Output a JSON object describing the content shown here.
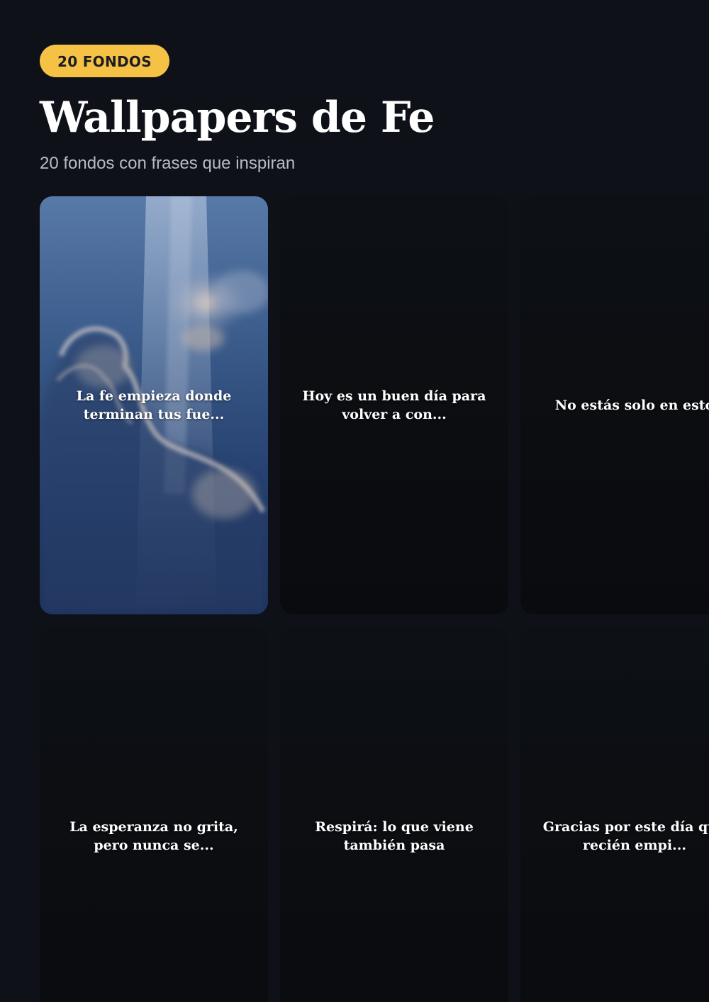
{
  "badge": "20 FONDOS",
  "title": "Wallpapers de Fe",
  "subtitle": "20 fondos con frases que inspiran",
  "colors": {
    "background": "#0e1218",
    "badge": "#f6c245",
    "badge_text": "#1b1d22",
    "card_dark": "#0b0d11",
    "sky_top": "#587aa8",
    "sky_bottom": "#1a2f58"
  },
  "wallpapers": [
    {
      "quote": "La fe empieza donde terminan tus fue...",
      "background": "clouds-sky-light-rays"
    },
    {
      "quote": "Hoy es un buen día para volver a con...",
      "background": "dark"
    },
    {
      "quote": "No estás solo en esto",
      "background": "dark"
    },
    {
      "quote": "La esperanza no grita, pero nunca se...",
      "background": "dark"
    },
    {
      "quote": "Respirá: lo que viene también pasa",
      "background": "dark"
    },
    {
      "quote": "Gracias por este día que recién empi...",
      "background": "dark"
    }
  ]
}
